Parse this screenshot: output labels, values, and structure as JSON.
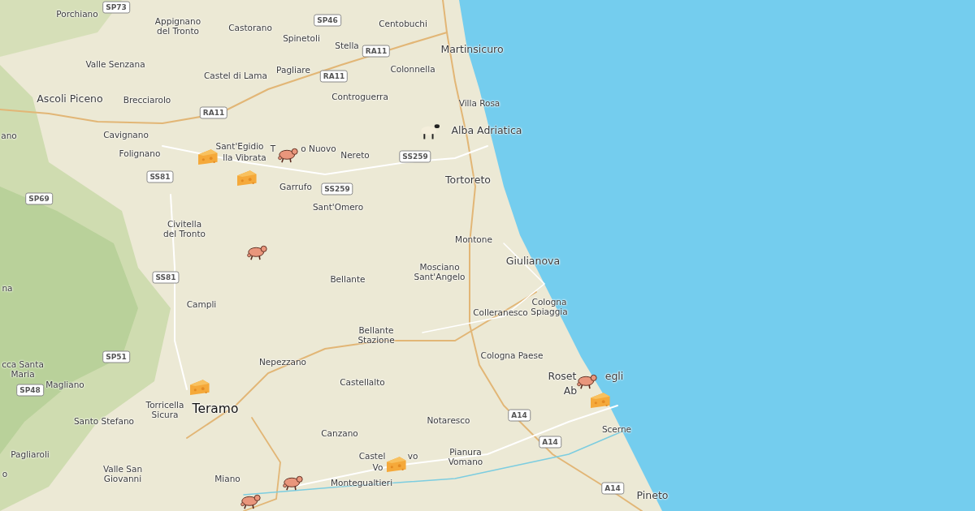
{
  "places": [
    {
      "lines": [
        "Porchiano"
      ],
      "kind": "village"
    },
    {
      "lines": [
        "Appignano",
        "del Tronto"
      ],
      "kind": "village"
    },
    {
      "lines": [
        "Castorano"
      ],
      "kind": "village"
    },
    {
      "lines": [
        "Centobuchi"
      ],
      "kind": "village"
    },
    {
      "lines": [
        "Spinetoli"
      ],
      "kind": "village"
    },
    {
      "lines": [
        "Stella"
      ],
      "kind": "village"
    },
    {
      "lines": [
        "Valle Senzana"
      ],
      "kind": "village"
    },
    {
      "lines": [
        "Martinsicuro"
      ],
      "kind": "town"
    },
    {
      "lines": [
        "Castel di Lama"
      ],
      "kind": "village"
    },
    {
      "lines": [
        "Pagliare"
      ],
      "kind": "village"
    },
    {
      "lines": [
        "Colonnella"
      ],
      "kind": "village"
    },
    {
      "lines": [
        "Ascoli Piceno"
      ],
      "kind": "town"
    },
    {
      "lines": [
        "Brecciarolo"
      ],
      "kind": "village"
    },
    {
      "lines": [
        "Controguerra"
      ],
      "kind": "village"
    },
    {
      "lines": [
        "Villa Rosa"
      ],
      "kind": "village"
    },
    {
      "lines": [
        "ano"
      ],
      "kind": "village"
    },
    {
      "lines": [
        "Cavignano"
      ],
      "kind": "village"
    },
    {
      "lines": [
        "Alba Adriatica"
      ],
      "kind": "town"
    },
    {
      "lines": [
        "Folignano"
      ],
      "kind": "village"
    },
    {
      "lines": [
        "Sant'Egidio"
      ],
      "kind": "village"
    },
    {
      "lines": [
        "lla Vibrata"
      ],
      "kind": "village"
    },
    {
      "lines": [
        "T"
      ],
      "kind": "village"
    },
    {
      "lines": [
        "o Nuovo"
      ],
      "kind": "village"
    },
    {
      "lines": [
        "Nereto"
      ],
      "kind": "village"
    },
    {
      "lines": [
        "Tortoreto"
      ],
      "kind": "town"
    },
    {
      "lines": [
        "Garrufo"
      ],
      "kind": "village"
    },
    {
      "lines": [
        "Sant'Omero"
      ],
      "kind": "village"
    },
    {
      "lines": [
        "Civitella",
        "del Tronto"
      ],
      "kind": "village"
    },
    {
      "lines": [
        "Montone"
      ],
      "kind": "village"
    },
    {
      "lines": [
        "Giulianova"
      ],
      "kind": "town"
    },
    {
      "lines": [
        "Bellante"
      ],
      "kind": "village"
    },
    {
      "lines": [
        "Mosciano",
        "Sant'Angelo"
      ],
      "kind": "village"
    },
    {
      "lines": [
        "na"
      ],
      "kind": "village"
    },
    {
      "lines": [
        "Campli"
      ],
      "kind": "village"
    },
    {
      "lines": [
        "Colleranesco"
      ],
      "kind": "village"
    },
    {
      "lines": [
        "Cologna",
        "Spiaggia"
      ],
      "kind": "village"
    },
    {
      "lines": [
        "Bellante",
        "Stazione"
      ],
      "kind": "village"
    },
    {
      "lines": [
        "cca Santa",
        "Maria"
      ],
      "kind": "village"
    },
    {
      "lines": [
        "Nepezzano"
      ],
      "kind": "village"
    },
    {
      "lines": [
        "Cologna Paese"
      ],
      "kind": "village"
    },
    {
      "lines": [
        "Magliano"
      ],
      "kind": "village"
    },
    {
      "lines": [
        "Castellalto"
      ],
      "kind": "village"
    },
    {
      "lines": [
        "Roset"
      ],
      "kind": "town"
    },
    {
      "lines": [
        "egli"
      ],
      "kind": "town"
    },
    {
      "lines": [
        "Ab"
      ],
      "kind": "town"
    },
    {
      "lines": [
        "Santo Stefano"
      ],
      "kind": "village"
    },
    {
      "lines": [
        "Torricella",
        "Sicura"
      ],
      "kind": "village"
    },
    {
      "lines": [
        "Teramo"
      ],
      "kind": "city"
    },
    {
      "lines": [
        "Notaresco"
      ],
      "kind": "village"
    },
    {
      "lines": [
        "Canzano"
      ],
      "kind": "village"
    },
    {
      "lines": [
        "Scerne"
      ],
      "kind": "village"
    },
    {
      "lines": [
        "Pagliaroli"
      ],
      "kind": "village"
    },
    {
      "lines": [
        "Castel"
      ],
      "kind": "village"
    },
    {
      "lines": [
        "Vo"
      ],
      "kind": "village"
    },
    {
      "lines": [
        "vo"
      ],
      "kind": "village"
    },
    {
      "lines": [
        "Pianura",
        "Vomano"
      ],
      "kind": "village"
    },
    {
      "lines": [
        "o"
      ],
      "kind": "village"
    },
    {
      "lines": [
        "Valle San",
        "Giovanni"
      ],
      "kind": "village"
    },
    {
      "lines": [
        "Miano"
      ],
      "kind": "village"
    },
    {
      "lines": [
        "Montegualtieri"
      ],
      "kind": "village"
    },
    {
      "lines": [
        "Pineto"
      ],
      "kind": "town"
    }
  ],
  "road_shields": [
    "SP73",
    "SP46",
    "RA11",
    "RA11",
    "RA11",
    "SS259",
    "SS81",
    "SS259",
    "SP69",
    "SS81",
    "SP51",
    "SP48",
    "A14",
    "A14",
    "A14"
  ],
  "markers": [
    {
      "kind": "cheese"
    },
    {
      "kind": "cheese"
    },
    {
      "kind": "pig"
    },
    {
      "kind": "sheep"
    },
    {
      "kind": "pig"
    },
    {
      "kind": "cheese"
    },
    {
      "kind": "pig"
    },
    {
      "kind": "cheese"
    },
    {
      "kind": "cheese"
    },
    {
      "kind": "pig"
    },
    {
      "kind": "pig"
    }
  ]
}
